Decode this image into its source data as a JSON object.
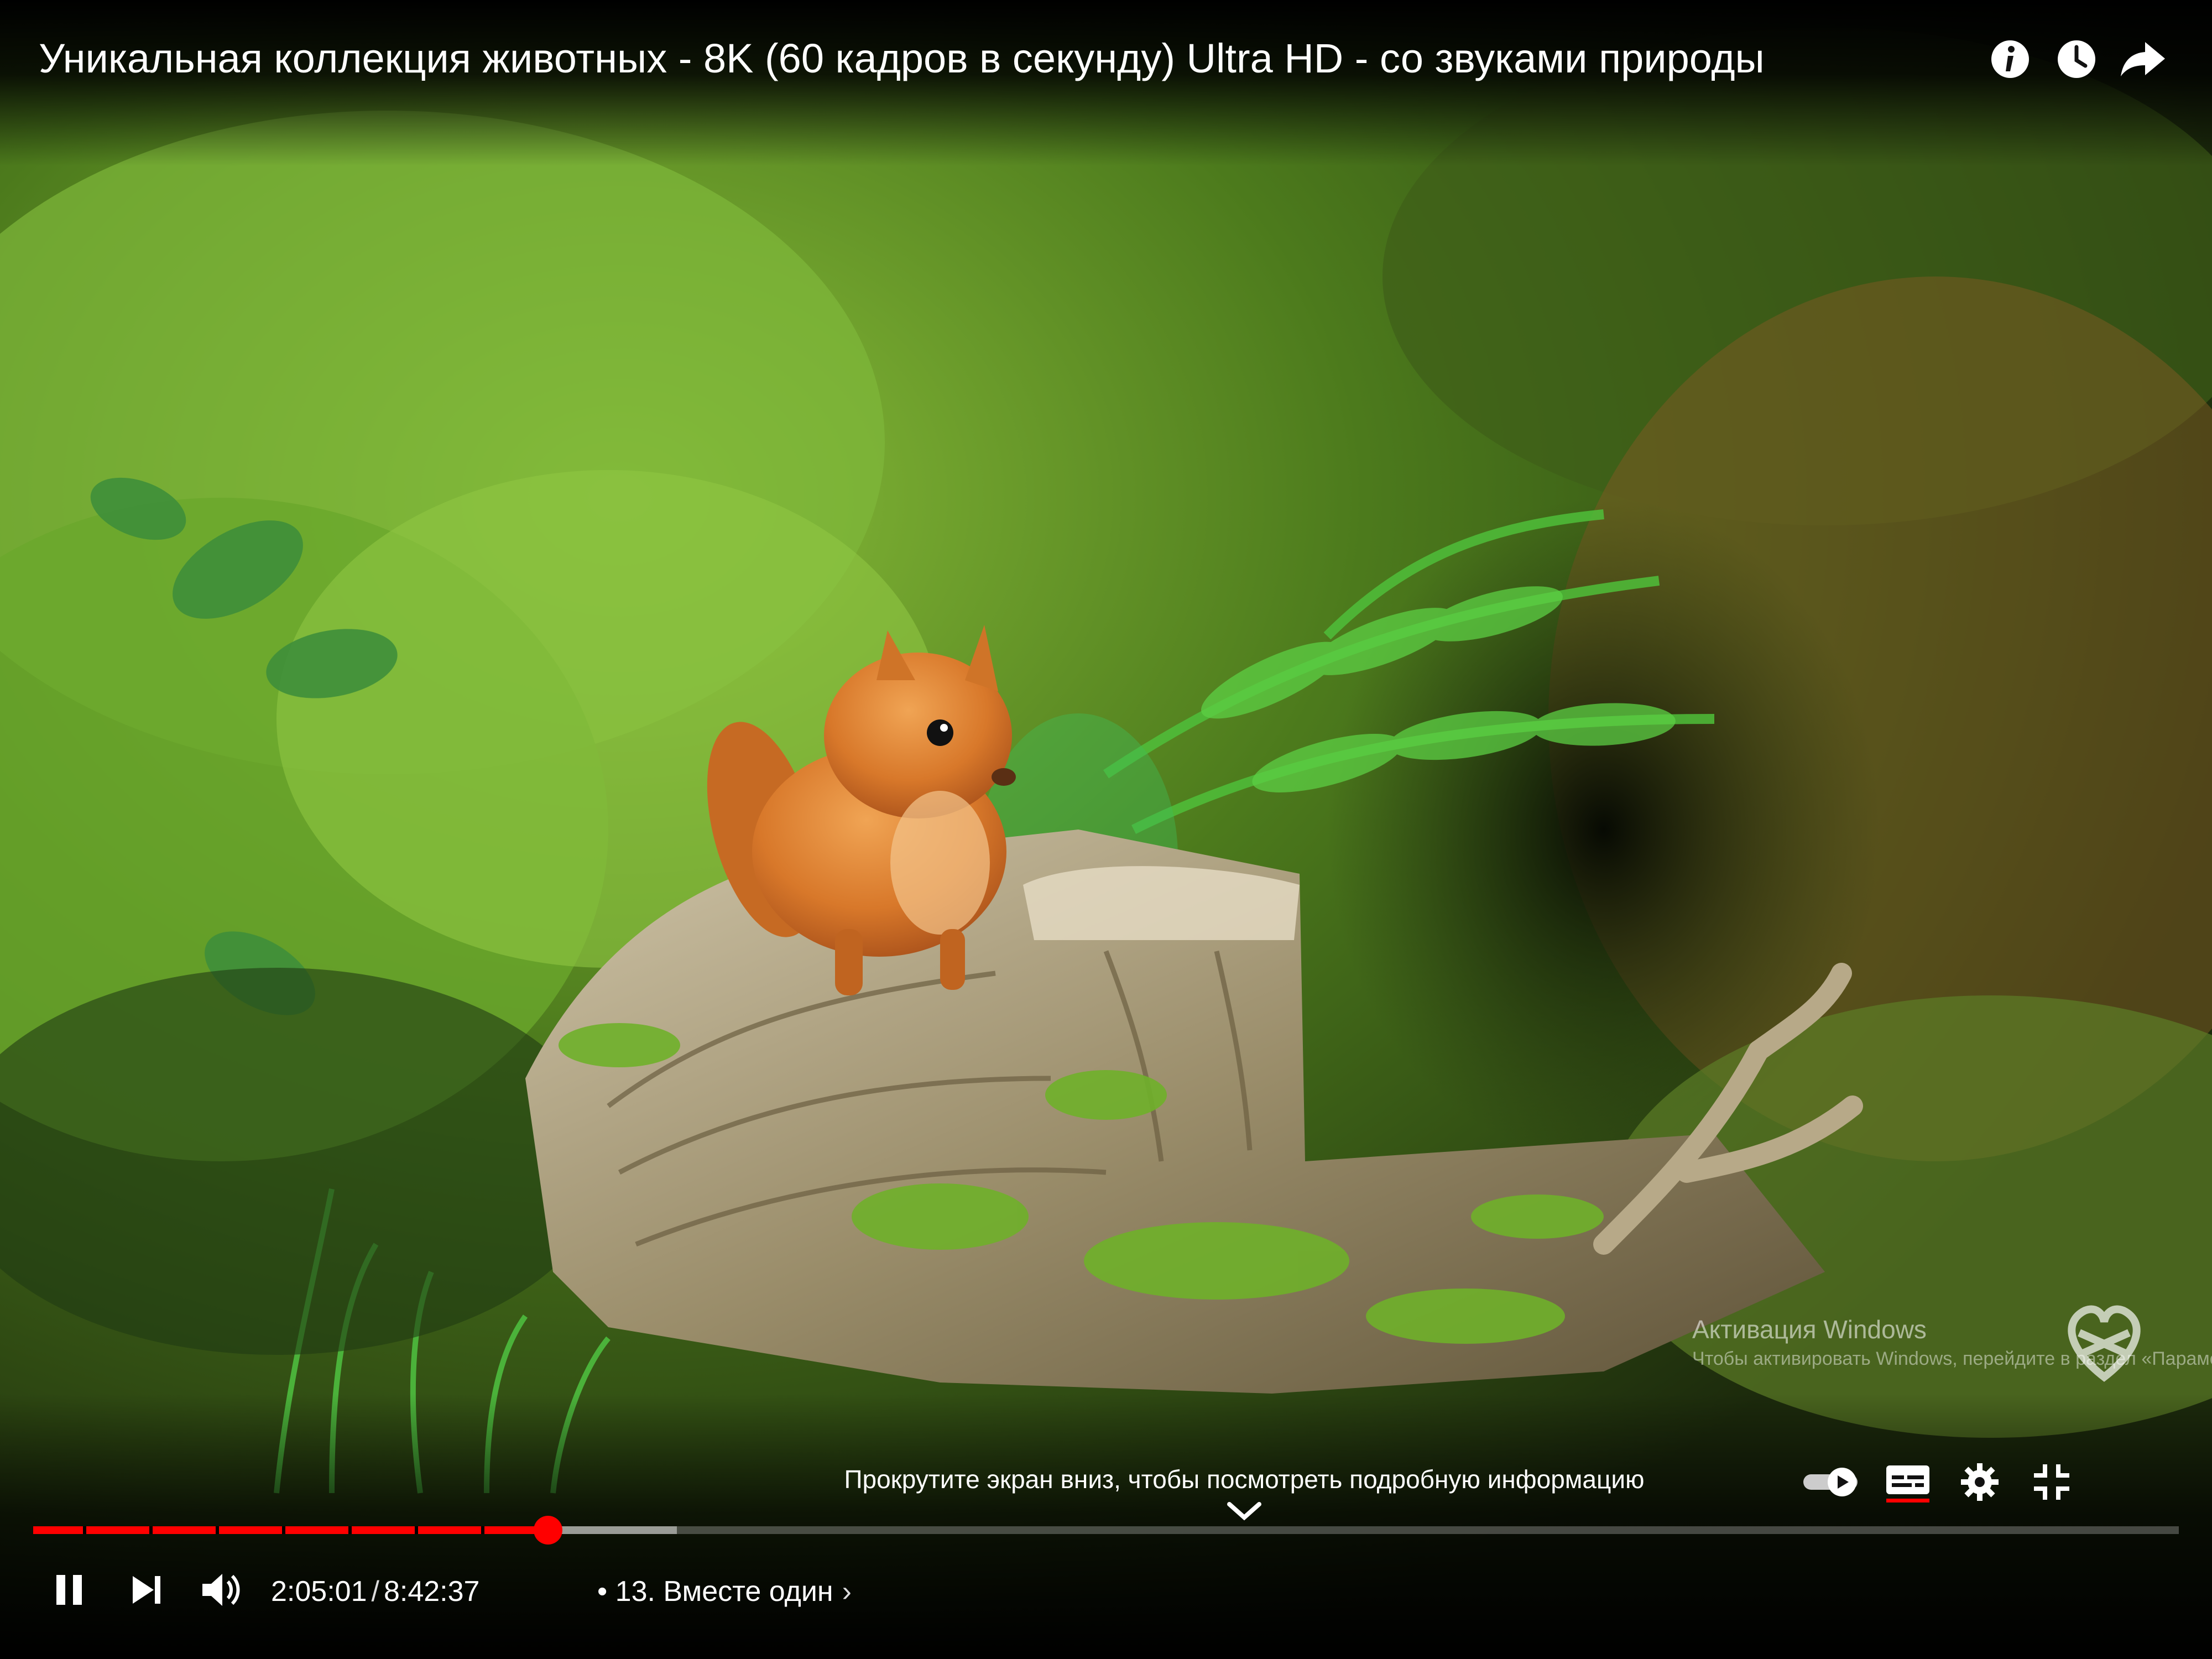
{
  "video": {
    "title": "Уникальная коллекция животных - 8K (60 кадров в секунду) Ultra HD - со звуками природы"
  },
  "top_actions": {
    "info_icon": "info-icon",
    "watch_later_icon": "clock-icon",
    "share_icon": "share-arrow-icon"
  },
  "playback": {
    "current_time": "2:05:01",
    "separator": "/",
    "duration": "8:42:37",
    "chapter_label": "• 13. Вместе один",
    "chapter_chevron": "›",
    "played_fraction": 0.24,
    "loaded_fraction": 0.06,
    "state": "playing"
  },
  "hints": {
    "scroll_hint": "Прокрутите экран вниз, чтобы посмотреть подробную информацию"
  },
  "controls": {
    "play_pause_icon": "pause-icon",
    "next_icon": "next-icon",
    "volume_icon": "volume-icon",
    "autoplay_icon": "autoplay-toggle-icon",
    "subtitles_icon": "subtitles-icon",
    "settings_icon": "gear-icon",
    "fullscreen_icon": "exit-fullscreen-icon"
  },
  "overlay": {
    "windows_activation": "Активация Windows",
    "windows_activation_sub": "Чтобы активировать Windows, перейдите в раздел «Параметры»."
  },
  "colors": {
    "progress_played": "#ff0000",
    "text": "#ffffff"
  }
}
